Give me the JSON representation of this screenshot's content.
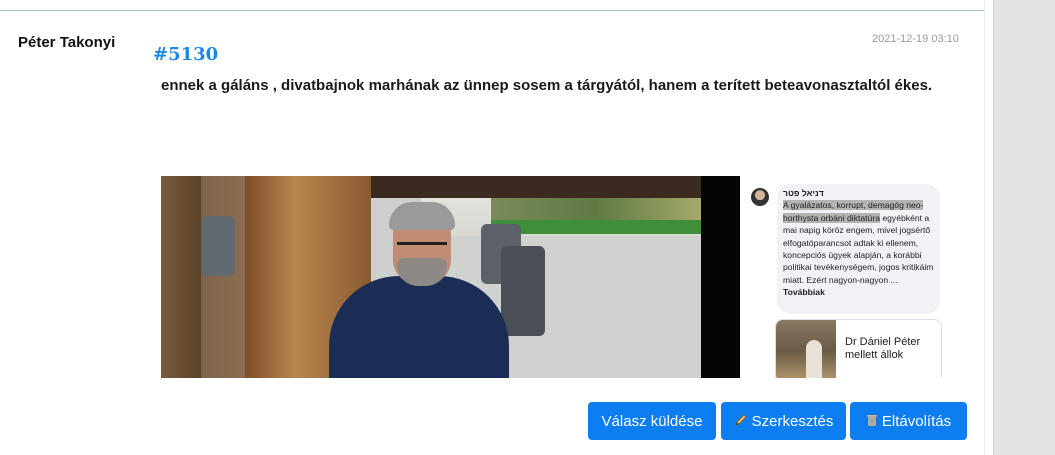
{
  "post": {
    "author": "Péter Takonyi",
    "id": "#5130",
    "timestamp": "2021-12-19 03:10",
    "body": "ennek a gáláns , divatbajnok marhának az ünnep sosem a tárgyától, hanem a terített beteavonasztaltól ékes."
  },
  "embedded": {
    "fb_name": "דניאל פטר",
    "comment_highlight": "A gyalázatos, korrupt, demagóg neo-horthysta orbáni diktatúra",
    "comment_rest": "egyébként a mai napig köröz engem, mivel jogsértő elfogatóparancsot adtak ki ellenem, koncepciós ügyek alapján, a korábbi politikai tevékenységem, jogos kritikáim miatt. Ezért nagyon-nagyon ...",
    "more_label": "Továbbiak",
    "card_text": "Dr Dániel Péter mellett állok"
  },
  "actions": {
    "reply_label": "Válasz küldése",
    "edit_label": "Szerkesztés",
    "delete_label": "Eltávolítás",
    "edit_icon": "pencil-icon",
    "delete_icon": "trash-icon"
  },
  "colors": {
    "accent": "#0d7ef2",
    "post_id": "#1e88e5"
  }
}
